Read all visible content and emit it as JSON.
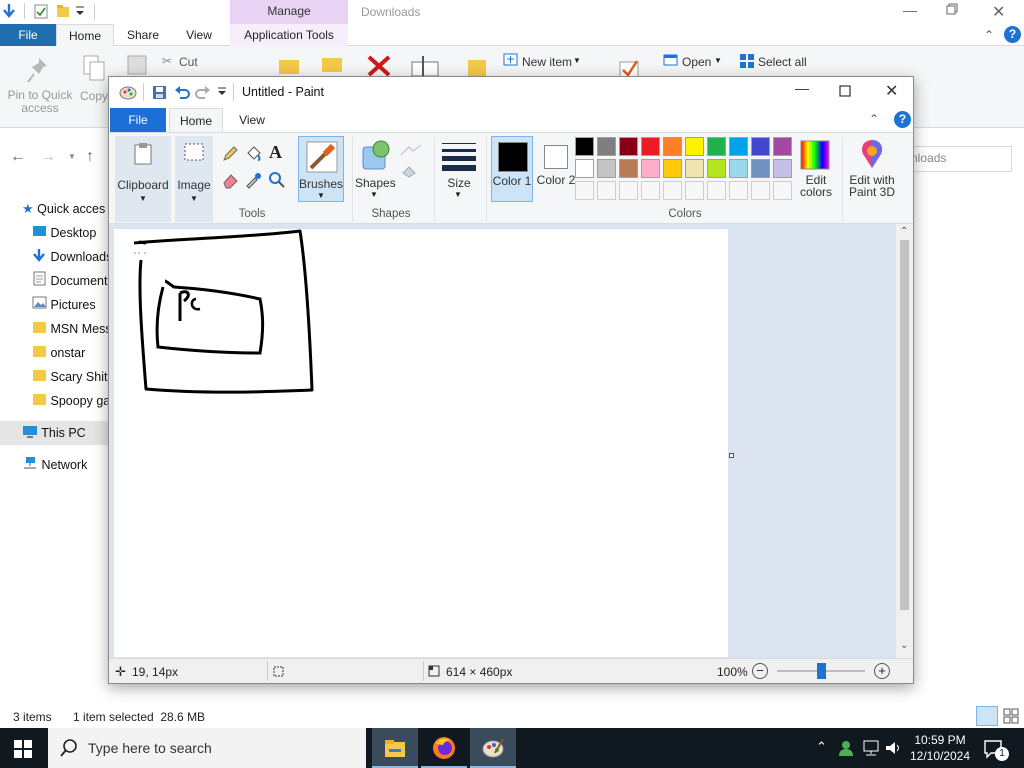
{
  "explorer": {
    "title": "Downloads",
    "context_tab": "Manage",
    "tabs": [
      "File",
      "Home",
      "Share",
      "View",
      "Application Tools"
    ],
    "ribbon": {
      "pin_label": "Pin to Quick access",
      "copy_label": "Copy",
      "cut_label": "Cut",
      "new_item_label": "New item",
      "open_label": "Open",
      "select_all_label": "Select all"
    },
    "search_placeholder": "nloads",
    "sidebar": [
      "Quick acces",
      "Desktop",
      "Downloads",
      "Documents",
      "Pictures",
      "MSN Mess",
      "onstar",
      "Scary Shit",
      "Spoopy ga",
      "This PC",
      "Network"
    ],
    "status": {
      "items": "3 items",
      "selected": "1 item selected  28.6 MB"
    }
  },
  "paint": {
    "title": "Untitled - Paint",
    "tabs": [
      "File",
      "Home",
      "View"
    ],
    "groups": {
      "clipboard": "Clipboard",
      "image": "Image",
      "tools": "Tools",
      "brushes": "Brushes",
      "shapes": "Shapes",
      "shapes_group": "Shapes",
      "size": "Size",
      "color1": "Color 1",
      "color2": "Color 2",
      "colors": "Colors",
      "edit_colors": "Edit colors",
      "edit_3d": "Edit with Paint 3D"
    },
    "drawing_text": "PC",
    "palette_row1": [
      "#000000",
      "#7f7f7f",
      "#880015",
      "#ed1c24",
      "#ff7f27",
      "#fff200",
      "#22b14c",
      "#00a2e8",
      "#3f48cc",
      "#a349a4"
    ],
    "palette_row2": [
      "#ffffff",
      "#c3c3c3",
      "#b97a57",
      "#ffaec9",
      "#ffc90e",
      "#efe4b0",
      "#b5e61d",
      "#99d9ea",
      "#7092be",
      "#c8bfe7"
    ],
    "color1": "#000000",
    "color2": "#ffffff",
    "status": {
      "cursor": "19, 14px",
      "size": "614 × 460px",
      "zoom": "100%"
    },
    "zoom_fraction": 0.5
  },
  "taskbar": {
    "search_placeholder": "Type here to search",
    "time": "10:59 PM",
    "date": "12/10/2024",
    "notifications": "1"
  }
}
